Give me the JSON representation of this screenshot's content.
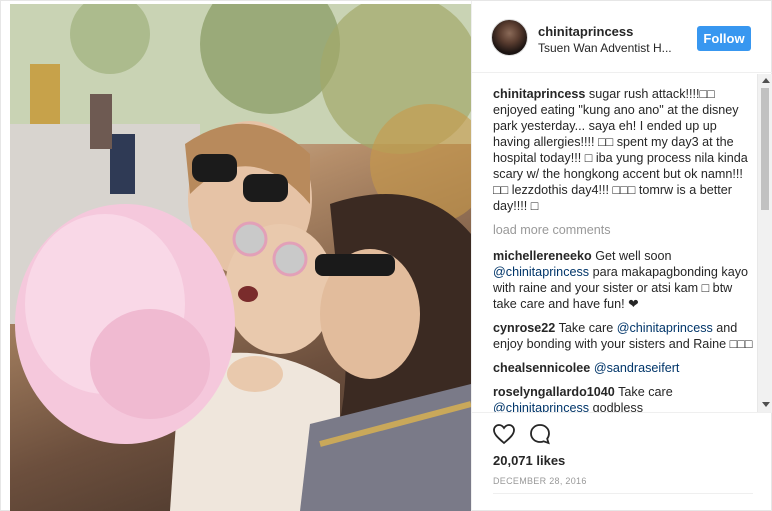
{
  "post": {
    "username": "chinitaprincess",
    "location": "Tsuen Wan Adventist H...",
    "follow_label": "Follow",
    "likes": "20,071 likes",
    "date": "DECEMBER 28, 2016",
    "load_more": "load more comments"
  },
  "caption": {
    "user": "chinitaprincess",
    "text": "sugar rush attack!!!!□□ enjoyed eating \"kung ano ano\" at the disney park yesterday... saya eh! I ended up up having allergies!!!! □□ spent my day3 at the hospital today!!! □ iba yung process nila kinda scary w/ the hongkong accent but ok namn!!!□□ lezzdothis day4!!! □□□ tomrw is a better day!!!! □"
  },
  "comments": [
    {
      "user": "michellereneeko",
      "text_pre": "Get well soon ",
      "mention": "@chinitaprincess",
      "text_post": " para makapagbonding kayo with raine and your sister or atsi kam □ btw take care and have fun! ❤"
    },
    {
      "user": "cynrose22",
      "text_pre": "Take care ",
      "mention": "@chinitaprincess",
      "text_post": " and enjoy bonding with your sisters and Raine □□□"
    },
    {
      "user": "chealsennicolee",
      "text_pre": "",
      "mention": "@sandraseifert",
      "text_post": ""
    },
    {
      "user": "roselyngallardo1040",
      "text_pre": "Take care ",
      "mention": "@chinitaprincess",
      "text_post": " godbless"
    }
  ],
  "icons": {
    "like": "heart-icon",
    "comment": "comment-bubble-icon",
    "avatar": "profile-avatar"
  },
  "colors": {
    "follow_button": "#3897f0",
    "mention": "#003569",
    "muted": "#999999"
  }
}
